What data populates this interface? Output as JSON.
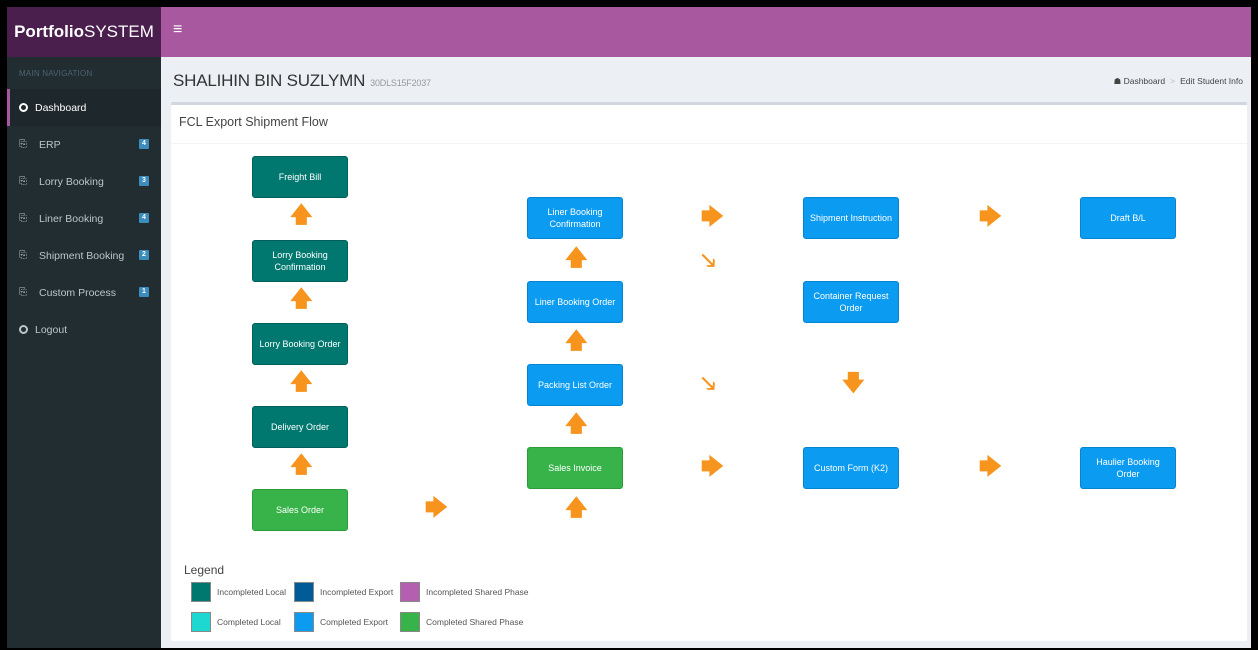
{
  "brand": {
    "bold": "Portfolio",
    "rest": "SYSTEM"
  },
  "topbar": {
    "menu_icon": "≡"
  },
  "sidebar": {
    "header": "MAIN NAVIGATION",
    "items": [
      {
        "label": "Dashboard",
        "icon": "circle-icon"
      },
      {
        "label": "ERP",
        "icon": "files-icon",
        "badge": "4"
      },
      {
        "label": "Lorry Booking",
        "icon": "files-icon",
        "badge": "3"
      },
      {
        "label": "Liner Booking",
        "icon": "files-icon",
        "badge": "4"
      },
      {
        "label": "Shipment Booking",
        "icon": "files-icon",
        "badge": "2"
      },
      {
        "label": "Custom Process",
        "icon": "files-icon",
        "badge": "1"
      },
      {
        "label": "Logout",
        "icon": "circle-icon"
      }
    ]
  },
  "header": {
    "title": "SHALIHIN BIN SUZLYMN",
    "subtitle": "30DLS15F2037",
    "breadcrumb": [
      "Dashboard",
      "Edit Student Info"
    ]
  },
  "box": {
    "title": "FCL Export Shipment Flow"
  },
  "flow": {
    "freight_bill": "Freight Bill",
    "lorry_booking_confirmation": "Lorry Booking Confirmation",
    "lorry_booking_order": "Lorry Booking Order",
    "delivery_order": "Delivery Order",
    "sales_order": "Sales Order",
    "liner_booking_confirmation": "Liner Booking Confirmation",
    "liner_booking_order": "Liner Booking Order",
    "packing_list_order": "Packing List Order",
    "sales_invoice": "Sales Invoice",
    "shipment_instruction": "Shipment Instruction",
    "container_request_order": "Container Request Order",
    "custom_form": "Custom Form (K2)",
    "draft_bl": "Draft B/L",
    "haulier_booking_order": "Haulier Booking Order"
  },
  "legend": {
    "title": "Legend",
    "items": [
      {
        "label": "Incompleted Local",
        "color": "#00786f"
      },
      {
        "label": "Incompleted Export",
        "color": "#005b96"
      },
      {
        "label": "Incompleted Shared Phase",
        "color": "#b55fb0"
      },
      {
        "label": "Completed Local",
        "color": "#1dd8d0"
      },
      {
        "label": "Completed Export",
        "color": "#0b9bf0"
      },
      {
        "label": "Completed Shared Phase",
        "color": "#37b34a"
      }
    ]
  },
  "colors": {
    "brand": "#4a1f4e",
    "topbar": "#a8589f",
    "sidebar": "#222d32",
    "arrow": "#f7941d"
  }
}
